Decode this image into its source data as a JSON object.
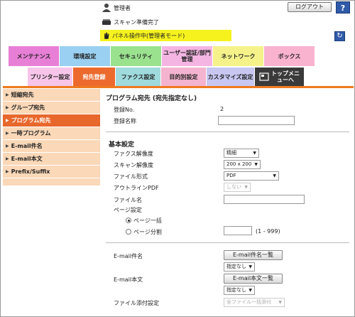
{
  "header": {
    "user": "管理者",
    "status": "スキャン準備完了",
    "mode": "パネル操作中(管理者モード)",
    "logout_label": "ログアウト",
    "help_label": "?",
    "refresh_label": "↻"
  },
  "tabs_main": [
    {
      "label": "メンテナンス",
      "color": "#e87fd6",
      "width": 72
    },
    {
      "label": "環境設定",
      "color": "#9ad0f2",
      "width": 72
    },
    {
      "label": "セキュリティ",
      "color": "#9be28f",
      "width": 72
    },
    {
      "label": "ユーザー認証/部門管理",
      "color": "#f5b5e3",
      "width": 72
    },
    {
      "label": "ネットワーク",
      "color": "#f5f28a",
      "width": 72
    },
    {
      "label": "ボックス",
      "color": "#f9b3cf",
      "width": 72
    }
  ],
  "tabs_sub": [
    {
      "label": "プリンター設定",
      "color": "#f6c5e9",
      "width": 64
    },
    {
      "label": "宛先登録",
      "color": "#ec6a2e",
      "width": 60
    },
    {
      "label": "ファクス設定",
      "color": "#9fdadd",
      "width": 64
    },
    {
      "label": "目的別設定",
      "color": "#f4b3cf",
      "width": 64
    },
    {
      "label": "カスタマイズ設定",
      "color": "#c7c7f2",
      "width": 68
    },
    {
      "label": "トップメニューへ",
      "color": "#3a3a3a",
      "width": 70
    }
  ],
  "sidebar": {
    "items": [
      {
        "label": "短縮宛先"
      },
      {
        "label": "グループ宛先"
      },
      {
        "label": "プログラム宛先"
      },
      {
        "label": "一時プログラム"
      },
      {
        "label": "E-mail件名"
      },
      {
        "label": "E-mail本文"
      },
      {
        "label": "Prefix/Suffix"
      }
    ]
  },
  "main": {
    "title": "プログラム宛先 (宛先指定なし)",
    "reg_no_label": "登録No.",
    "reg_no_value": "2",
    "reg_name_label": "登録名称",
    "reg_name_value": "",
    "basic_title": "基本設定",
    "fax_res_label": "ファクス解像度",
    "fax_res_value": "精細",
    "scan_res_label": "スキャン解像度",
    "scan_res_value": "200 x 200",
    "file_type_label": "ファイル形式",
    "file_type_value": "PDF",
    "outline_label": "アウトラインPDF",
    "outline_value": "しない",
    "file_name_label": "ファイル名",
    "file_name_value": "",
    "page_setting_label": "ページ設定",
    "page_batch_label": "ページ一括",
    "page_split_label": "ページ分割",
    "page_split_value": "",
    "page_split_range": "(1 - 999)",
    "email_subject_label": "E-mail件名",
    "email_subject_btn": "E-mail件名一覧",
    "email_subject_value": "指定なし",
    "email_body_label": "E-mail本文",
    "email_body_btn": "E-mail本文一覧",
    "email_body_value": "指定なし",
    "attach_label": "ファイル添付設定",
    "attach_value": "全ファイル一括添付"
  }
}
